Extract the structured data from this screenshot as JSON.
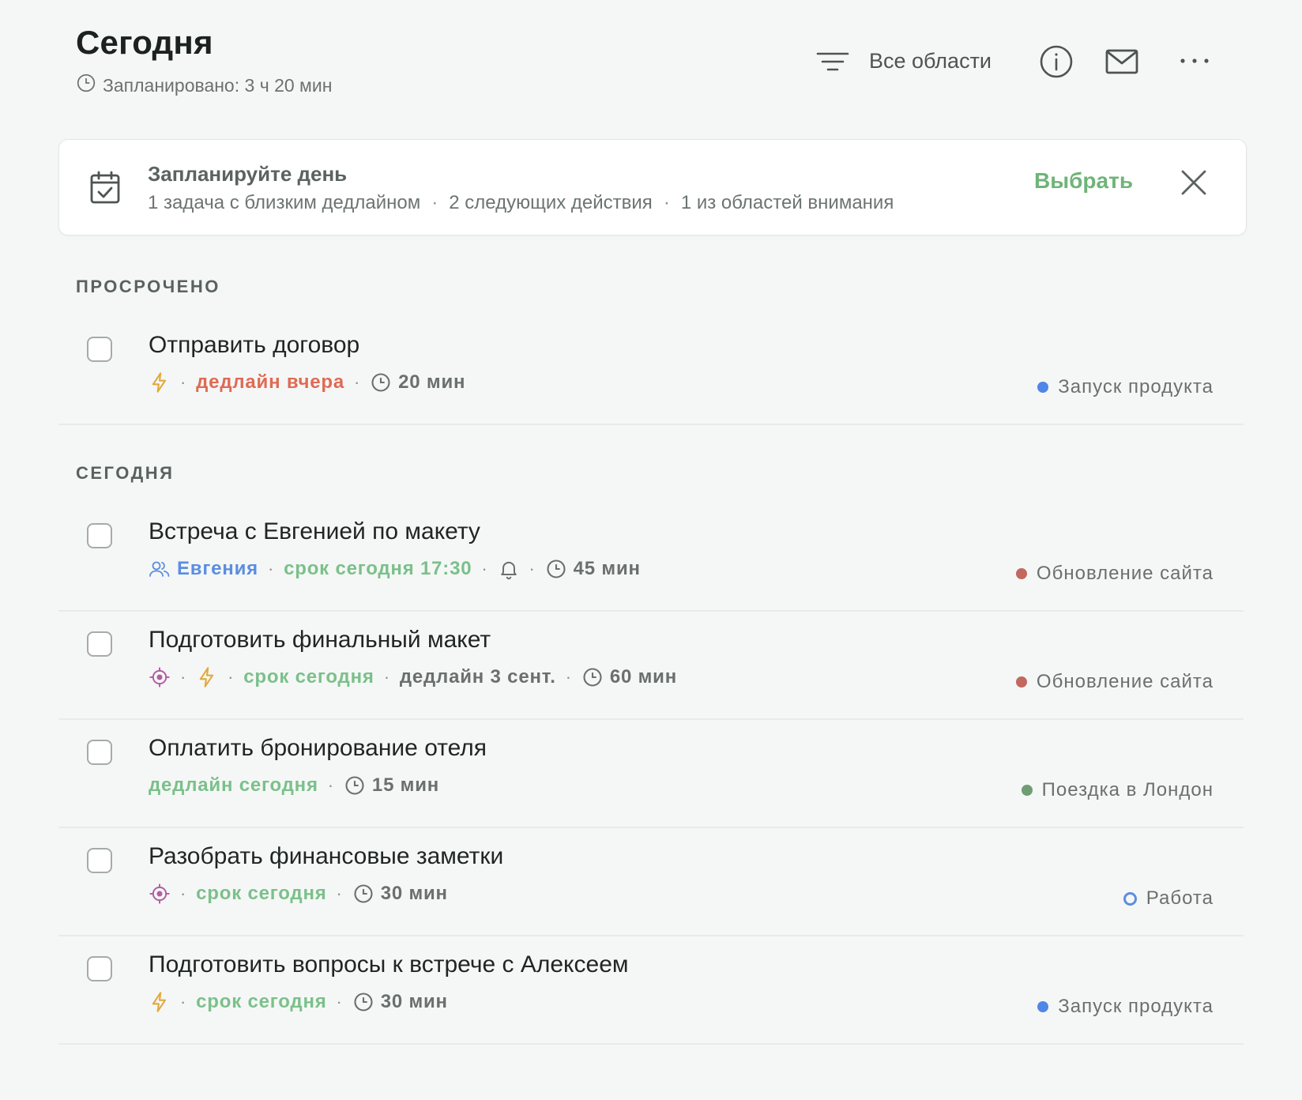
{
  "header": {
    "title": "Сегодня",
    "planned": "Запланировано: 3 ч 20 мин",
    "filter_label": "Все области"
  },
  "banner": {
    "title": "Запланируйте день",
    "items": [
      "1 задача с близким дедлайном",
      "2 следующих действия",
      "1 из областей внимания"
    ],
    "separator": "·",
    "action": "Выбрать"
  },
  "sections": {
    "overdue": "ПРОСРОЧЕНО",
    "today": "СЕГОДНЯ"
  },
  "meta_sep": "·",
  "colors": {
    "launch": "#4f86e8",
    "site": "#c2685f",
    "london": "#6e9d74",
    "work": "#5b8ee0",
    "accent_green": "#6fb479",
    "deadline_red": "#e06a54"
  },
  "tasks": [
    {
      "title": "Отправить договор",
      "deadline": "дедлайн вчера",
      "duration": "20 мин",
      "area": "Запуск продукта"
    },
    {
      "title": "Встреча с Евгенией по макету",
      "person": "Евгения",
      "due": "срок сегодня 17:30",
      "duration": "45 мин",
      "area": "Обновление сайта"
    },
    {
      "title": "Подготовить финальный макет",
      "due": "срок сегодня",
      "deadline": "дедлайн 3 сент.",
      "duration": "60 мин",
      "area": "Обновление сайта"
    },
    {
      "title": "Оплатить бронирование отеля",
      "deadline": "дедлайн сегодня",
      "duration": "15 мин",
      "area": "Поездка в Лондон"
    },
    {
      "title": "Разобрать финансовые заметки",
      "due": "срок сегодня",
      "duration": "30 мин",
      "area": "Работа"
    },
    {
      "title": "Подготовить вопросы к встрече с Алексеем",
      "due": "срок сегодня",
      "duration": "30 мин",
      "area": "Запуск продукта"
    }
  ]
}
